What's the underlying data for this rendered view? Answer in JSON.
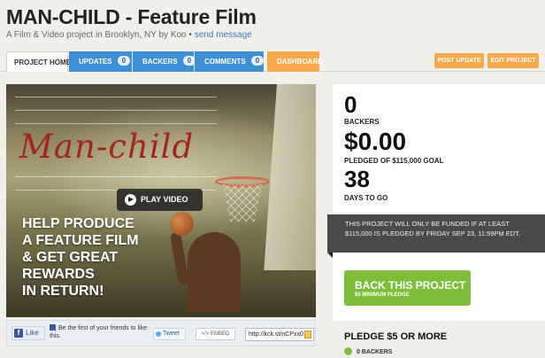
{
  "header": {
    "title": "MAN-CHILD - Feature Film",
    "subtitle_prefix": "A Film & Video project in Brooklyn, NY by Koo • ",
    "send_message": "send message"
  },
  "tabs": [
    {
      "label": "PROJECT HOME"
    },
    {
      "label": "UPDATES",
      "count": "0"
    },
    {
      "label": "BACKERS",
      "count": "0"
    },
    {
      "label": "COMMENTS",
      "count": "0"
    },
    {
      "label": "DASHBOARD"
    }
  ],
  "actions": {
    "post_update": "POST UPDATE",
    "edit_project": "EDIT PROJECT"
  },
  "video": {
    "handwritten_title": "Man-child",
    "play_label": "PLAY VIDEO",
    "overlay_lines": [
      "HELP PRODUCE",
      "A FEATURE FILM",
      "& GET GREAT",
      "REWARDS",
      "IN RETURN!"
    ]
  },
  "share": {
    "like_label": "Like",
    "fb_text": "Be the first of your friends to like this.",
    "tweet_label": "Tweet",
    "embed_label": "EMBED",
    "short_url": "http://kck.st/nCPxx0"
  },
  "stats": {
    "backers_value": "0",
    "backers_label": "BACKERS",
    "pledged_value": "$0.00",
    "pledged_label": "PLEDGED OF $115,000 GOAL",
    "days_value": "38",
    "days_label": "DAYS TO GO"
  },
  "notice": "THIS PROJECT WILL ONLY BE FUNDED IF AT LEAST $115,000 IS PLEDGED BY FRIDAY SEP 23, 11:59PM EDT.",
  "back_button": {
    "label": "BACK THIS PROJECT",
    "sub": "$5 MINIMUM PLEDGE"
  },
  "reward": {
    "title": "PLEDGE $5 OR MORE",
    "backers": "0 BACKERS"
  },
  "colors": {
    "tab_blue": "#3d8fd6",
    "tab_orange": "#f6a94a",
    "back_green": "#7ebd3a",
    "notice_bg": "#4a4a4a"
  }
}
